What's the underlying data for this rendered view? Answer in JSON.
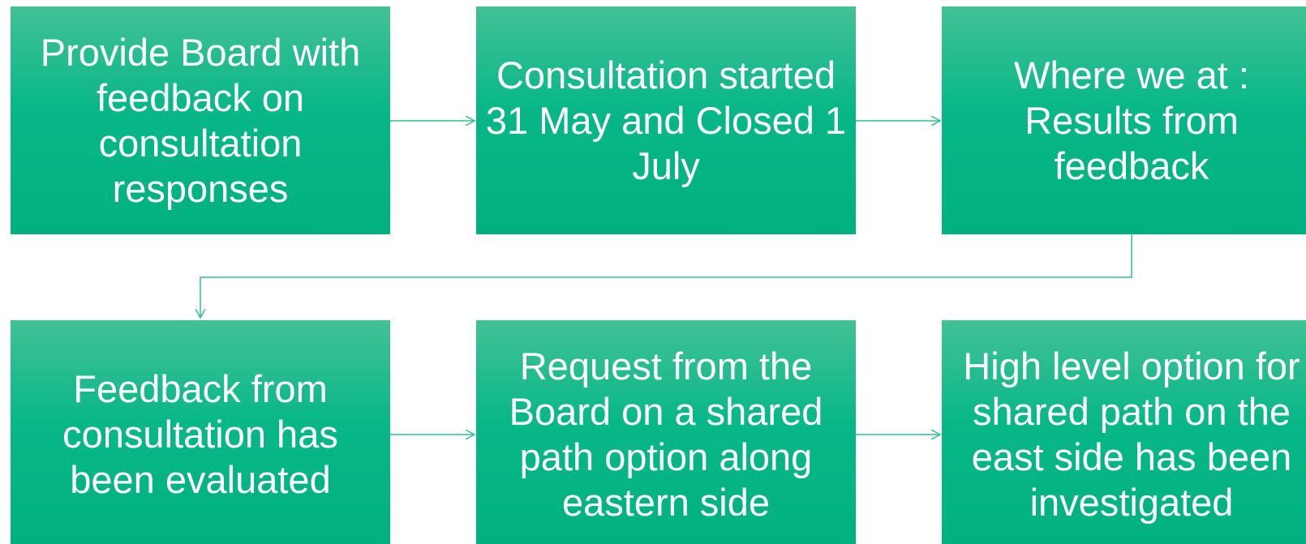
{
  "diagram": {
    "accent_color": "#00b17f",
    "connector_color": "#2fbf94",
    "text_color": "#ffffff",
    "nodes": [
      {
        "id": "b1",
        "label": "Provide Board with feedback on consultation responses"
      },
      {
        "id": "b2",
        "label": "Consultation started 31 May and Closed 1 July"
      },
      {
        "id": "b3",
        "label": "Where we at : Results from feedback"
      },
      {
        "id": "b4",
        "label": "Feedback from consultation has been evaluated"
      },
      {
        "id": "b5",
        "label": "Request from the Board on a shared path option along eastern side"
      },
      {
        "id": "b6",
        "label": "High level option for shared path on the east side has been investigated"
      }
    ],
    "edges": [
      {
        "from": "b1",
        "to": "b2"
      },
      {
        "from": "b2",
        "to": "b3"
      },
      {
        "from": "b3",
        "to": "b4"
      },
      {
        "from": "b4",
        "to": "b5"
      },
      {
        "from": "b5",
        "to": "b6"
      }
    ]
  }
}
